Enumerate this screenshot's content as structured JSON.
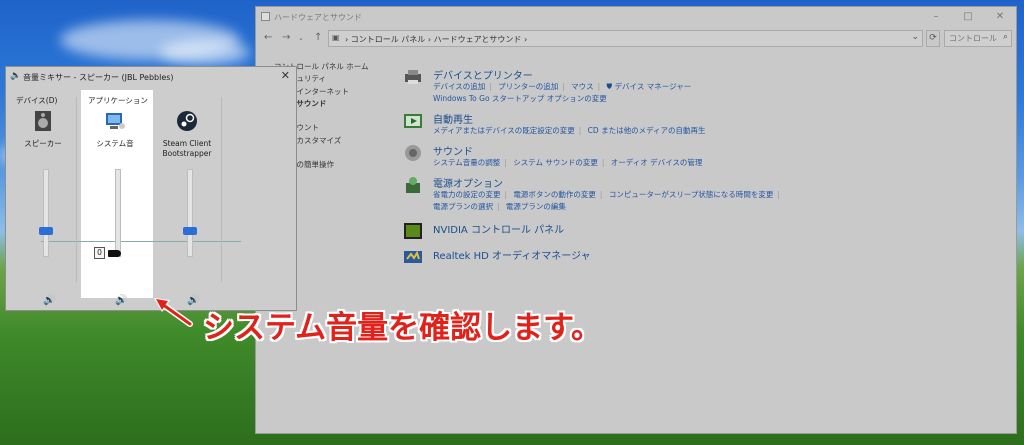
{
  "control_panel": {
    "title": "ハードウェアとサウンド",
    "address": [
      "コントロール パネル",
      "ハードウェアとサウンド"
    ],
    "search_placeholder": "コントロール...",
    "sidebar": [
      {
        "label": "コントロール パネル ホーム"
      },
      {
        "label": "とセキュリティ"
      },
      {
        "label": "ークとインターネット"
      },
      {
        "label": "ェアとサウンド"
      },
      {
        "label": "ム"
      },
      {
        "label": "・アカウント"
      },
      {
        "label": "ップのカスタマイズ"
      },
      {
        "label": "地域"
      },
      {
        "label": "ーターの簡単操作"
      }
    ],
    "categories": [
      {
        "title": "デバイスとプリンター",
        "links": [
          [
            "デバイスの追加",
            "プリンターの追加",
            "マウス",
            "デバイス マネージャー"
          ],
          [
            "Windows To Go スタートアップ オプションの変更"
          ]
        ]
      },
      {
        "title": "自動再生",
        "links": [
          [
            "メディアまたはデバイスの既定設定の変更",
            "CD または他のメディアの自動再生"
          ]
        ]
      },
      {
        "title": "サウンド",
        "links": [
          [
            "システム音量の調整",
            "システム サウンドの変更",
            "オーディオ デバイスの管理"
          ]
        ]
      },
      {
        "title": "電源オプション",
        "links": [
          [
            "省電力の設定の変更",
            "電源ボタンの動作の変更",
            "コンピューターがスリープ状態になる時間を変更"
          ],
          [
            "電源プランの選択",
            "電源プランの編集"
          ]
        ]
      },
      {
        "title": "NVIDIA コントロール パネル",
        "links": []
      },
      {
        "title": "Realtek HD オーディオマネージャ",
        "links": []
      }
    ]
  },
  "mixer": {
    "title": "音量ミキサー - スピーカー (JBL Pebbles)",
    "device_label": "デバイス(D)",
    "app_label": "アプリケーション",
    "device_name": "スピーカー",
    "app1_name": "システム音",
    "app2_name": "Steam Client Bootstrapper",
    "tooltip_value": "0",
    "levels": {
      "device": 0.3,
      "system": 0,
      "steam": 0.3
    }
  },
  "annotation": "システム音量を確認します。"
}
